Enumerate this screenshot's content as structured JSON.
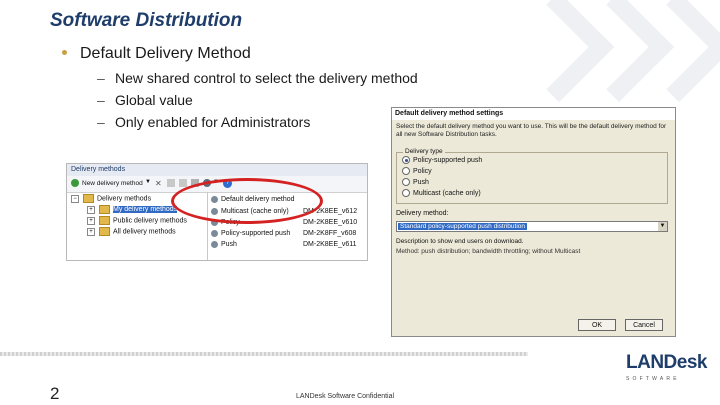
{
  "slide": {
    "title": "Software Distribution",
    "bullet": "Default Delivery Method",
    "subbullets": [
      "New shared control to select the delivery method",
      "Global value",
      "Only enabled for Administrators"
    ],
    "page_number": "2",
    "confidential": "LANDesk Software Confidential"
  },
  "logo": {
    "name": "LANDesk",
    "sub": "SOFTWARE"
  },
  "left_window": {
    "title": "Delivery methods",
    "toolbar": {
      "new_label": "New delivery method",
      "default_label": "Default delivery method"
    },
    "tree": [
      "Delivery methods",
      "My delivery methods",
      "Public delivery methods",
      "All delivery methods"
    ],
    "list": [
      {
        "name": "Multicast (cache only)",
        "owner": "DM-2K8EE_v612"
      },
      {
        "name": "Policy",
        "owner": "DM-2K8EE_v610"
      },
      {
        "name": "Policy-supported push",
        "owner": "DM-2K8FF_v608"
      },
      {
        "name": "Push",
        "owner": "DM-2K8EE_v611"
      }
    ],
    "highlight_color": "#d42222"
  },
  "dialog": {
    "title": "Default delivery method settings",
    "description": "Select the default delivery method you want to use. This will be the default delivery method for all new Software Distribution tasks.",
    "group_label": "Delivery type",
    "radios": [
      "Policy-supported push",
      "Policy",
      "Push",
      "Multicast (cache only)"
    ],
    "selected_radio": 0,
    "method_label": "Delivery method:",
    "method_value": "Standard policy-supported push distribution",
    "method_desc1": "Description to show end users on download.",
    "method_desc2": "Method: push distribution; bandwidth throttling; without Multicast",
    "ok_label": "OK",
    "cancel_label": "Cancel"
  }
}
